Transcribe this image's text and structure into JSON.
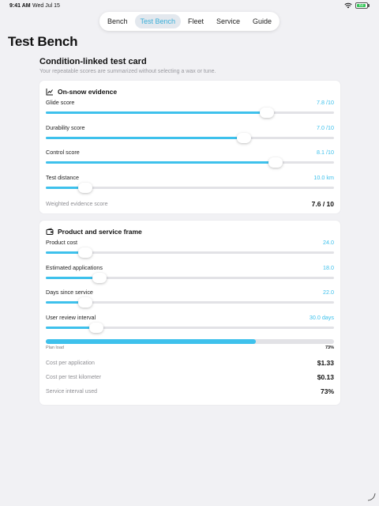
{
  "status": {
    "time": "9:41 AM",
    "date": "Wed Jul 15",
    "battery": "83"
  },
  "tabs": [
    {
      "label": "Bench",
      "active": false
    },
    {
      "label": "Test Bench",
      "active": true
    },
    {
      "label": "Fleet",
      "active": false
    },
    {
      "label": "Service",
      "active": false
    },
    {
      "label": "Guide",
      "active": false
    }
  ],
  "page_title": "Test Bench",
  "section": {
    "title": "Condition-linked test card",
    "subtitle": "Your repeatable scores are summarized without selecting a wax or tune."
  },
  "evidence_card": {
    "title": "On-snow evidence",
    "icon": "line-chart-icon",
    "sliders": [
      {
        "label": "Glide score",
        "value": "7.8 /10",
        "level": 0.768
      },
      {
        "label": "Durability score",
        "value": "7.0 /10",
        "level": 0.688
      },
      {
        "label": "Control score",
        "value": "8.1 /10",
        "level": 0.797
      },
      {
        "label": "Test distance",
        "value": "10.0 km",
        "level": 0.137
      }
    ],
    "weighted_label": "Weighted evidence score",
    "weighted_value": "7.6 / 10"
  },
  "frame_card": {
    "title": "Product and service frame",
    "icon": "wallet-icon",
    "sliders": [
      {
        "label": "Product cost",
        "value": "24.0",
        "level": 0.137
      },
      {
        "label": "Estimated applications",
        "value": "18.0",
        "level": 0.187
      },
      {
        "label": "Days since service",
        "value": "22.0",
        "level": 0.137
      },
      {
        "label": "User review interval",
        "value": "30.0 days",
        "level": 0.175
      }
    ],
    "plan_load": {
      "label": "Plan load",
      "percent": "73%",
      "level": 0.73
    },
    "rows": [
      {
        "label": "Cost per application",
        "value": "$1.33"
      },
      {
        "label": "Cost per test kilometer",
        "value": "$0.13"
      },
      {
        "label": "Service interval used",
        "value": "73%"
      }
    ]
  },
  "colors": {
    "accent": "#3ec1ec",
    "background": "#f1f1f4",
    "track": "#e2e2e6"
  }
}
